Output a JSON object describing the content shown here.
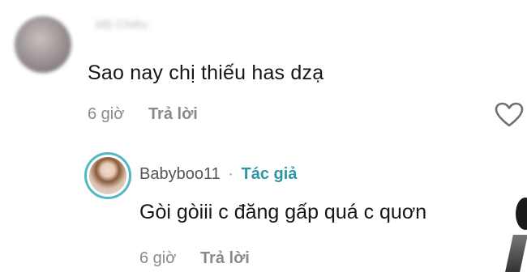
{
  "comments": [
    {
      "author": "Mộ Chiêu",
      "text": "Sao nay chị thiếu has dzạ",
      "time": "6 giờ",
      "reply_label": "Trả lời"
    }
  ],
  "reply": {
    "author": "Babyboo11",
    "separator": "·",
    "author_badge": "Tác giả",
    "text": "Gòi gòiii c đăng gấp quá c quơn",
    "time": "6 giờ",
    "reply_label": "Trả lời"
  },
  "colors": {
    "accent": "#2b97a3",
    "avatar_ring": "#52b8c4",
    "muted": "#8a8a8a"
  },
  "icons": [
    "heart-icon"
  ]
}
